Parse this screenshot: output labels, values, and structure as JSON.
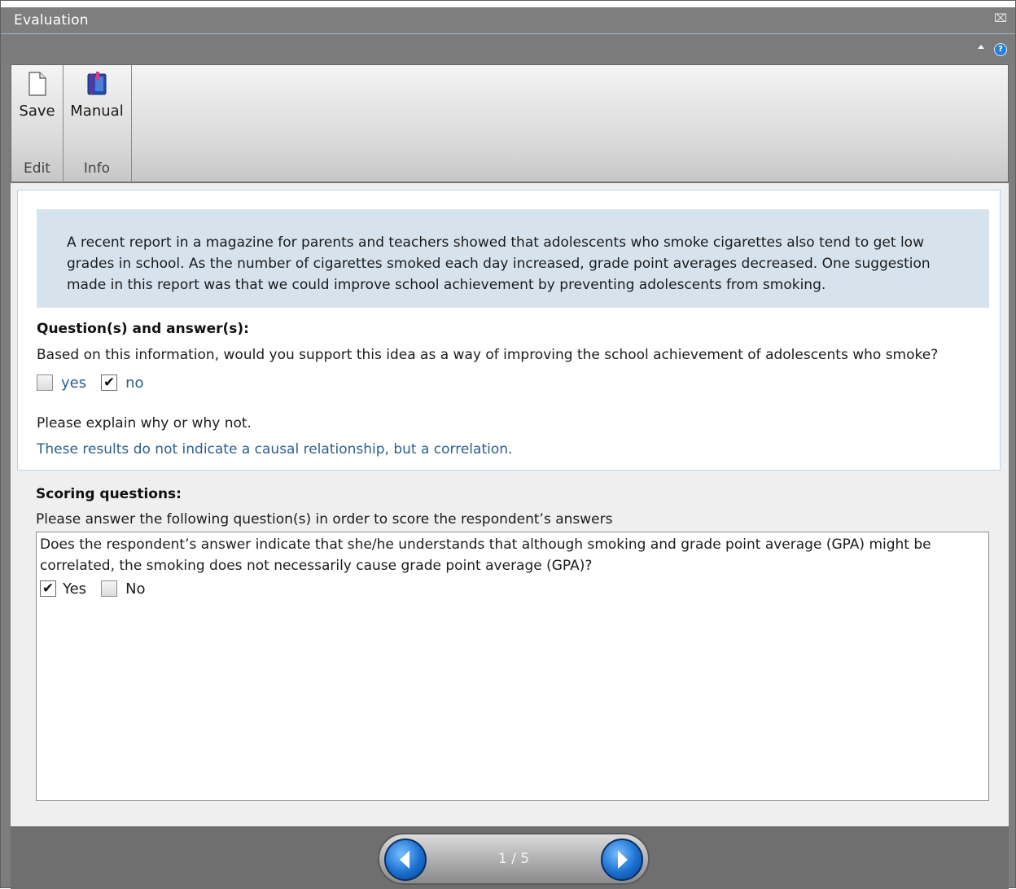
{
  "window": {
    "title": "Evaluation",
    "close_glyph": "⌧"
  },
  "toolbar": {
    "help_glyph": "?",
    "groups": [
      {
        "label": "Edit",
        "button_label": "Save",
        "icon": "document-icon"
      },
      {
        "label": "Info",
        "button_label": "Manual",
        "icon": "manual-book-icon"
      }
    ]
  },
  "scenario": {
    "text": "A recent report in a magazine for parents and teachers showed that adolescents who smoke cigarettes also tend to get low grades in school. As the number of cigarettes smoked each day increased, grade point averages decreased. One suggestion made in this report was that we could improve school achievement by preventing adolescents from smoking."
  },
  "qa": {
    "heading": "Question(s) and answer(s):",
    "question": "Based on this information, would you support this idea as a way of improving the school achievement of adolescents who smoke?",
    "options": [
      {
        "label": "yes",
        "checked": false
      },
      {
        "label": "no",
        "checked": true
      }
    ],
    "explain_prompt": "Please explain why or why not.",
    "explain_answer": "These results do not indicate a causal relationship, but a correlation."
  },
  "scoring": {
    "heading": "Scoring questions:",
    "instructions": "Please answer the following question(s) in order to score the respondent’s answers",
    "question": "Does the respondent’s answer indicate that she/he understands that although smoking and grade point average (GPA) might be correlated, the smoking does not necessarily cause grade point average (GPA)?",
    "options": [
      {
        "label": "Yes",
        "checked": true
      },
      {
        "label": "No",
        "checked": false
      }
    ]
  },
  "pager": {
    "indicator": "1 / 5"
  },
  "colors": {
    "accent_blue": "#2b5f8f",
    "scenario_bg": "#d6e3ed",
    "nav_button": "#1a6fd0"
  }
}
